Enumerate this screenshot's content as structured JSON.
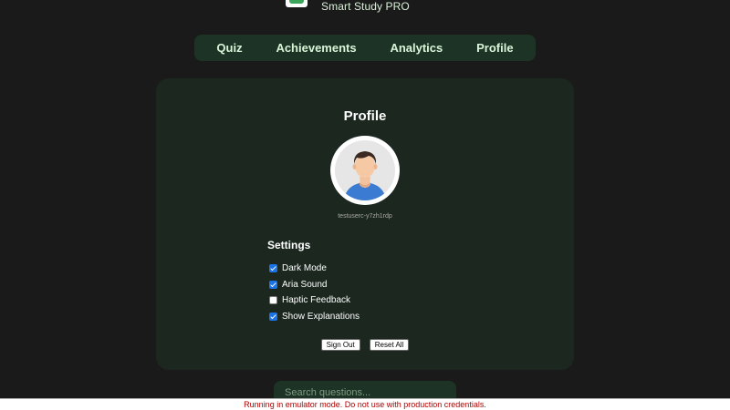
{
  "app": {
    "title": "Smart Study PRO",
    "logo_icon": "brain-icon",
    "accent_color": "#3ba55c"
  },
  "nav": {
    "items": [
      {
        "label": "Quiz"
      },
      {
        "label": "Achievements"
      },
      {
        "label": "Analytics"
      },
      {
        "label": "Profile"
      }
    ]
  },
  "profile": {
    "title": "Profile",
    "avatar_icon": "user-avatar-icon",
    "username": "testuserc-y7zh1rdp"
  },
  "settings": {
    "title": "Settings",
    "items": [
      {
        "label": "Dark Mode",
        "checked": true
      },
      {
        "label": "Aria Sound",
        "checked": true
      },
      {
        "label": "Haptic Feedback",
        "checked": false
      },
      {
        "label": "Show Explanations",
        "checked": true
      }
    ]
  },
  "actions": {
    "sign_out": "Sign Out",
    "reset_all": "Reset All"
  },
  "search": {
    "placeholder": "Search questions..."
  },
  "banner": {
    "text": "Running in emulator mode. Do not use with production credentials."
  }
}
